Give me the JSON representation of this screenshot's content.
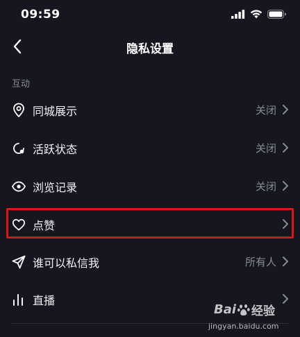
{
  "status_bar": {
    "time": "09:59",
    "icons": [
      "signal-icon",
      "wifi-icon",
      "battery-icon"
    ]
  },
  "nav": {
    "back_icon": "chevron-left-icon",
    "title": "隐私设置"
  },
  "section": {
    "label": "互动"
  },
  "rows": [
    {
      "icon": "location-pin-icon",
      "label": "同城展示",
      "value": "关闭"
    },
    {
      "icon": "activity-status-icon",
      "label": "活跃状态",
      "value": "关闭"
    },
    {
      "icon": "eye-icon",
      "label": "浏览记录",
      "value": "关闭"
    },
    {
      "icon": "heart-icon",
      "label": "点赞",
      "value": ""
    },
    {
      "icon": "send-icon",
      "label": "谁可以私信我",
      "value": "所有人"
    },
    {
      "icon": "live-bars-icon",
      "label": "直播",
      "value": ""
    }
  ],
  "highlight_color": "#d9141c",
  "watermark": {
    "logo_left": "Bai",
    "logo_right": "经验",
    "url": "jingyan.baidu.com"
  }
}
